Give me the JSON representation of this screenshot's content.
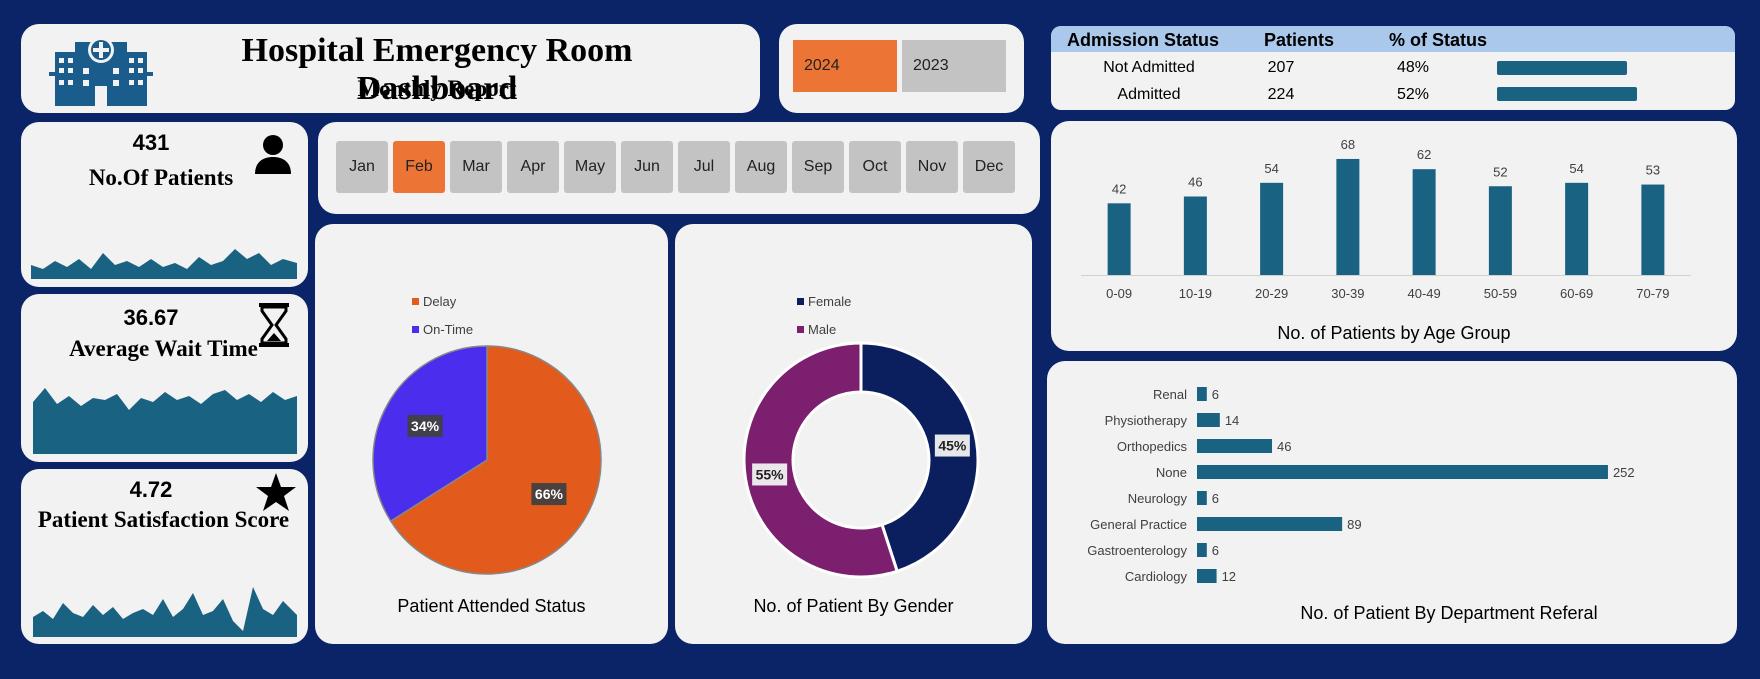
{
  "header": {
    "title": "Hospital Emergency Room Dashboard",
    "subtitle": "Monthly Report"
  },
  "years": [
    {
      "label": "2024",
      "active": true
    },
    {
      "label": "2023",
      "active": false
    }
  ],
  "admission": {
    "headers": [
      "Admission Status",
      "Patients",
      "% of Status"
    ],
    "rows": [
      {
        "status": "Not Admitted",
        "patients": "207",
        "pct": "48%",
        "share": 0.48
      },
      {
        "status": "Admitted",
        "patients": "224",
        "pct": "52%",
        "share": 0.52
      }
    ]
  },
  "kpis": {
    "patients": {
      "value": "431",
      "label": "No.Of Patients",
      "icon": "person-icon"
    },
    "wait": {
      "value": "36.67",
      "label": "Average Wait Time",
      "icon": "hourglass-icon"
    },
    "satisfaction": {
      "value": "4.72",
      "label": "Patient Satisfaction Score",
      "icon": "star-icon"
    }
  },
  "months": [
    {
      "label": "Jan",
      "active": false
    },
    {
      "label": "Feb",
      "active": true
    },
    {
      "label": "Mar",
      "active": false
    },
    {
      "label": "Apr",
      "active": false
    },
    {
      "label": "May",
      "active": false
    },
    {
      "label": "Jun",
      "active": false
    },
    {
      "label": "Jul",
      "active": false
    },
    {
      "label": "Aug",
      "active": false
    },
    {
      "label": "Sep",
      "active": false
    },
    {
      "label": "Oct",
      "active": false
    },
    {
      "label": "Nov",
      "active": false
    },
    {
      "label": "Dec",
      "active": false
    }
  ],
  "colors": {
    "background": "#0b2467",
    "panel": "#f2f2f2",
    "accent": "#ec7535",
    "bar": "#1a6282",
    "delay": "#e25b1c",
    "ontime": "#4b2ded",
    "female": "#0b1f5e",
    "male": "#7b1f6e"
  },
  "chart_data": [
    {
      "type": "pie",
      "title": "Patient Attended Status",
      "labels": [
        "Delay",
        "On-Time"
      ],
      "values": [
        66,
        34
      ],
      "value_labels": [
        "66%",
        "34%"
      ],
      "legend": "top-left"
    },
    {
      "type": "pie",
      "subtype": "donut",
      "title": "No. of Patient By Gender",
      "labels": [
        "Female",
        "Male"
      ],
      "values": [
        45,
        55
      ],
      "value_labels": [
        "45%",
        "55%"
      ],
      "legend": "top-left"
    },
    {
      "type": "bar",
      "title": "No. of Patients by Age Group",
      "categories": [
        "0-09",
        "10-19",
        "20-29",
        "30-39",
        "40-49",
        "50-59",
        "60-69",
        "70-79"
      ],
      "values": [
        42,
        46,
        54,
        68,
        62,
        52,
        54,
        53
      ],
      "ylim": [
        0,
        75
      ],
      "grid": false
    },
    {
      "type": "bar",
      "orientation": "horizontal",
      "title": "No. of Patient By Department Referal",
      "categories": [
        "Renal",
        "Physiotherapy",
        "Orthopedics",
        "None",
        "Neurology",
        "General Practice",
        "Gastroenterology",
        "Cardiology"
      ],
      "values": [
        6,
        14,
        46,
        252,
        6,
        89,
        6,
        12
      ],
      "xlim": [
        0,
        260
      ],
      "grid": false
    }
  ]
}
